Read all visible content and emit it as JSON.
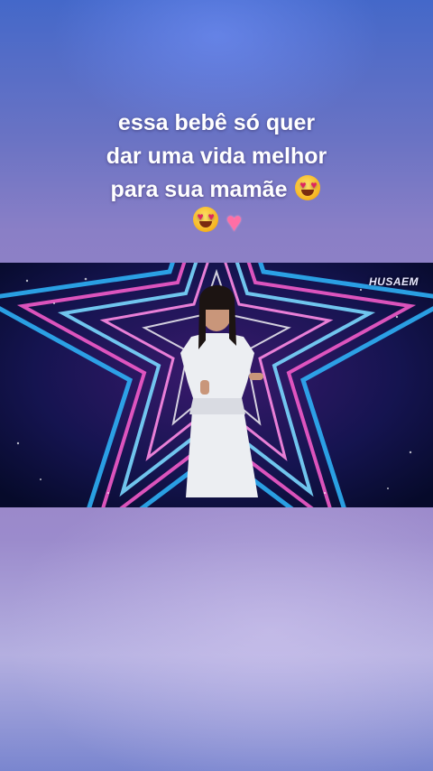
{
  "caption": {
    "line1": "essa bebê só quer",
    "line2": "dar uma vida melhor",
    "line3": "para sua mamãe"
  },
  "video": {
    "watermark": "HUSAEM"
  },
  "icons": {
    "caption_emojis": [
      "heart-eyes-face",
      "heart-eyes-face",
      "pink-heart"
    ]
  },
  "colors": {
    "background_top": "#4468c9",
    "background_mid": "#9b83c6",
    "stage_neon_blue": "#2fb8ff",
    "stage_neon_pink": "#ff5fd0"
  }
}
